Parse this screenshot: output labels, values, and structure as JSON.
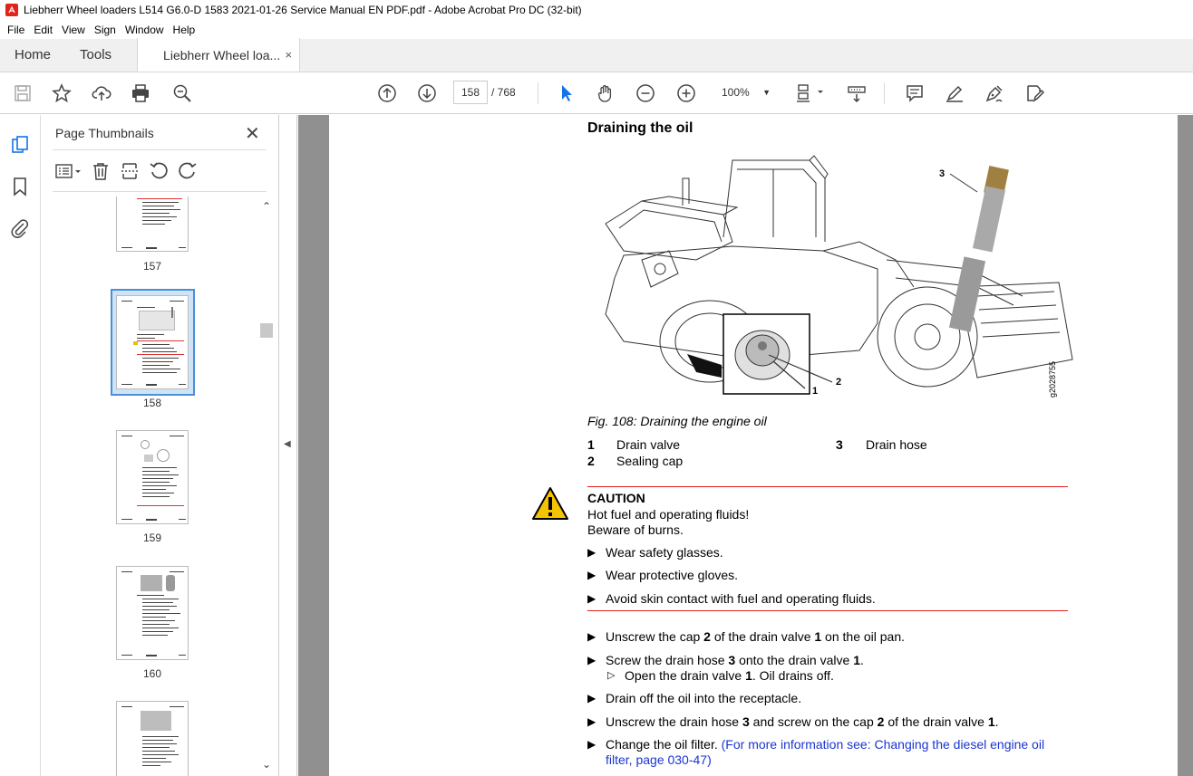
{
  "window": {
    "title": "Liebherr Wheel loaders L514 G6.0-D 1583 2021-01-26 Service Manual EN PDF.pdf - Adobe Acrobat Pro DC (32-bit)"
  },
  "menu": [
    "File",
    "Edit",
    "View",
    "Sign",
    "Window",
    "Help"
  ],
  "tabs": {
    "home": "Home",
    "tools": "Tools",
    "document": "Liebherr Wheel loa...",
    "close_glyph": "×"
  },
  "toolbar": {
    "current_page": "158",
    "page_total": "/  768",
    "zoom": "100%"
  },
  "thumbnails": {
    "title": "Page Thumbnails",
    "pages": [
      "157",
      "158",
      "159",
      "160"
    ],
    "selected_page": "158"
  },
  "document": {
    "heading": "Draining the oil",
    "figure_callouts": [
      "1",
      "2",
      "3"
    ],
    "figure_code": "g2028755",
    "figure_caption": "Fig. 108: Draining the engine oil",
    "legend": [
      {
        "num": "1",
        "label": "Drain valve"
      },
      {
        "num": "2",
        "label": "Sealing cap"
      },
      {
        "num": "3",
        "label": "Drain hose"
      }
    ],
    "caution": {
      "title": "CAUTION",
      "line1": "Hot fuel and operating fluids!",
      "line2": "Beware of burns.",
      "bullets": [
        "Wear safety glasses.",
        "Wear protective gloves.",
        "Avoid skin contact with fuel and operating fluids."
      ]
    },
    "steps": {
      "s1_a": "Unscrew the cap ",
      "s1_b": "2",
      "s1_c": " of the drain valve ",
      "s1_d": "1",
      "s1_e": " on the oil pan.",
      "s2_a": "Screw the drain hose ",
      "s2_b": "3",
      "s2_c": " onto the drain valve ",
      "s2_d": "1",
      "s2_e": ".",
      "s2_sub_a": "Open the drain valve ",
      "s2_sub_b": "1",
      "s2_sub_c": ". Oil drains off.",
      "s3": "Drain off the oil into the receptacle.",
      "s4_a": "Unscrew the drain hose ",
      "s4_b": "3",
      "s4_c": " and screw on the cap ",
      "s4_d": "2",
      "s4_e": " of the drain valve ",
      "s4_f": "1",
      "s4_g": ".",
      "s5_a": "Change the oil filter. ",
      "s5_link1": "(For more information see: Changing the diesel engine oil",
      "s5_link2": "filter, page 030-47)"
    }
  },
  "colors": {
    "accent_red": "#e02020",
    "link_blue": "#1a35d0",
    "selection_blue": "#4a90d9",
    "doc_background": "#909090"
  }
}
